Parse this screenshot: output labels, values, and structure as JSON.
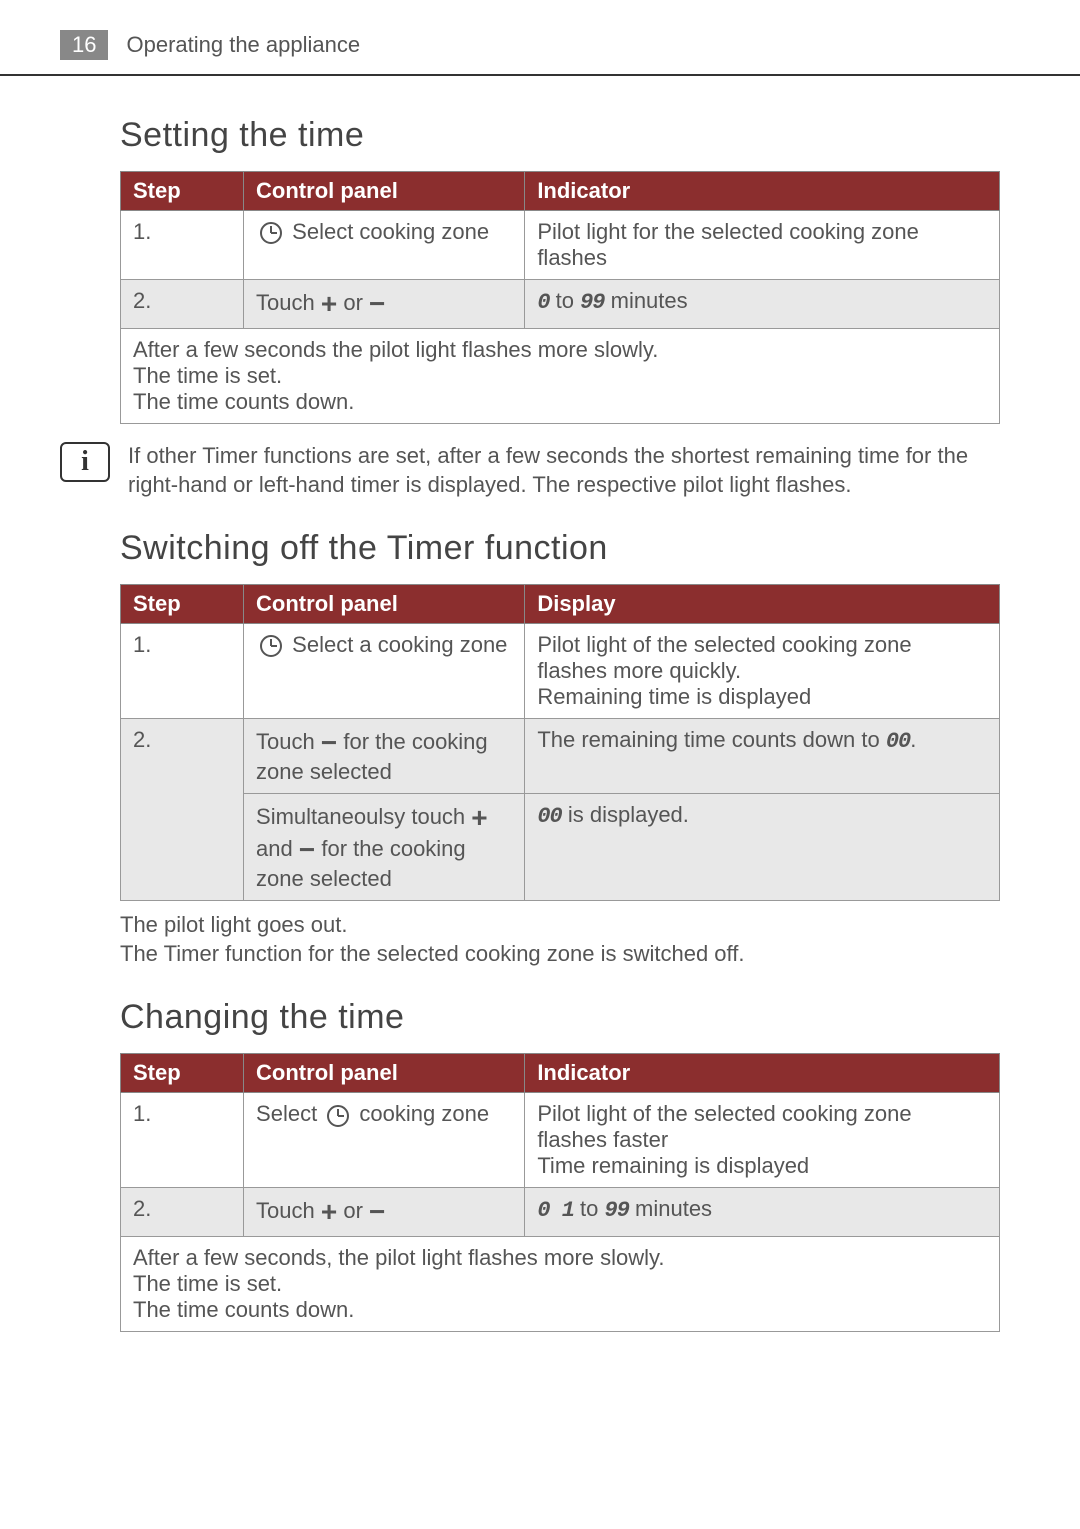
{
  "header": {
    "page_num": "16",
    "title": "Operating the appliance"
  },
  "section1": {
    "title": "Setting the time",
    "th_step": "Step",
    "th_cp": "Control panel",
    "th_ind": "Indicator",
    "r1_step": "1.",
    "r1_cp": " Select cooking zone",
    "r1_ind": "Pilot light for the selected cooking zone flashes",
    "r2_step": "2.",
    "r2_cp_a": "Touch ",
    "r2_cp_b": " or ",
    "r2_ind_a": "0",
    "r2_ind_b": " to ",
    "r2_ind_c": "99",
    "r2_ind_d": "  minutes",
    "footer": "After a few seconds the pilot light flashes more slowly.\nThe time is set.\nThe time counts down."
  },
  "info1": "If other Timer functions are set, after a few seconds the shortest remaining time for the right-hand or left-hand timer is displayed. The respective pilot light flashes.",
  "section2": {
    "title": "Switching off the Timer function",
    "th_step": "Step",
    "th_cp": "Control panel",
    "th_disp": "Display",
    "r1_step": "1.",
    "r1_cp": " Select a cooking zone",
    "r1_disp": "Pilot light of the selected cooking zone flashes more quickly.\nRemaining time is displayed",
    "r2_step": "2.",
    "r2_cp_a": "Touch ",
    "r2_cp_b": " for the cooking zone selected",
    "r2_disp_a": "The remaining time counts down to ",
    "r2_disp_b": "00",
    "r2_disp_c": ".",
    "r3_cp_a": "Simultaneoulsy touch ",
    "r3_cp_b": " and ",
    "r3_cp_c": " for the cooking zone selected",
    "r3_disp_a": "00",
    "r3_disp_b": " is displayed."
  },
  "footnote2": "The pilot light goes out.\nThe Timer function for the selected cooking zone is switched off.",
  "section3": {
    "title": "Changing the time",
    "th_step": "Step",
    "th_cp": "Control panel",
    "th_ind": "Indicator",
    "r1_step": "1.",
    "r1_cp_a": "Select ",
    "r1_cp_b": "  cooking zone",
    "r1_ind": "Pilot light of the selected cooking zone flashes faster\nTime remaining is displayed",
    "r2_step": "2.",
    "r2_cp_a": "Touch ",
    "r2_cp_b": " or ",
    "r2_ind_a": "0 1",
    "r2_ind_b": " to ",
    "r2_ind_c": "99",
    "r2_ind_d": "  minutes",
    "footer": "After a few seconds, the pilot light flashes more slowly.\nThe time is set.\nThe time counts down."
  }
}
